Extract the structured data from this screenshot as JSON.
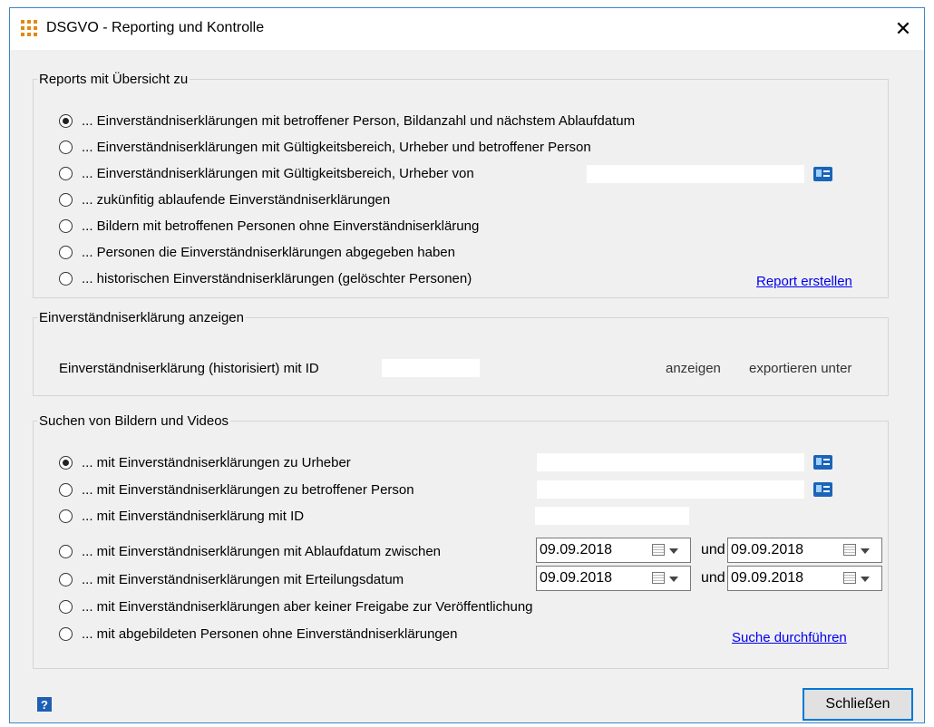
{
  "window": {
    "title": "DSGVO - Reporting und Kontrolle",
    "close_glyph": "✕"
  },
  "reports": {
    "legend": "Reports mit Übersicht zu",
    "options": [
      "... Einverständniserklärungen mit betroffener Person, Bildanzahl und nächstem Ablaufdatum",
      "... Einverständniserklärungen mit Gültigkeitsbereich, Urheber und betroffener Person",
      "... Einverständniserklärungen mit Gültigkeitsbereich, Urheber  von",
      "... zukünfitig ablaufende Einverständniserklärungen",
      "... Bildern mit betroffenen Personen ohne Einverständniserklärung",
      "... Personen die Einverständniserklärungen abgegeben haben",
      "... historischen Einverständniserklärungen (gelöschter Personen)"
    ],
    "selected_index": 0,
    "von_value": "",
    "create_link": "Report erstellen"
  },
  "consent": {
    "legend": "Einverständniserklärung anzeigen",
    "label": "Einverständniserklärung (historisiert) mit ID",
    "id_value": "",
    "show_action": "anzeigen",
    "export_action": "exportieren unter"
  },
  "search": {
    "legend": "Suchen von Bildern und Videos",
    "options": [
      "... mit Einverständniserklärungen zu Urheber",
      "... mit Einverständniserklärungen zu betroffener Person",
      "... mit Einverständniserklärung mit ID",
      "... mit Einverständniserklärungen mit Ablaufdatum zwischen",
      "... mit Einverständniserklärungen mit Erteilungsdatum",
      "... mit Einverständniserklärungen aber keiner Freigabe zur Veröffentlichung",
      "... mit abgebildeten Personen ohne Einverständniserklärungen"
    ],
    "selected_index": 0,
    "urheber_value": "",
    "person_value": "",
    "id_value": "",
    "expiry_from": "09.09.2018",
    "expiry_to": "09.09.2018",
    "grant_from": "09.09.2018",
    "grant_to": "09.09.2018",
    "und_label": "und",
    "search_link": "Suche durchführen"
  },
  "footer": {
    "help_glyph": "?",
    "close_button": "Schließen"
  }
}
